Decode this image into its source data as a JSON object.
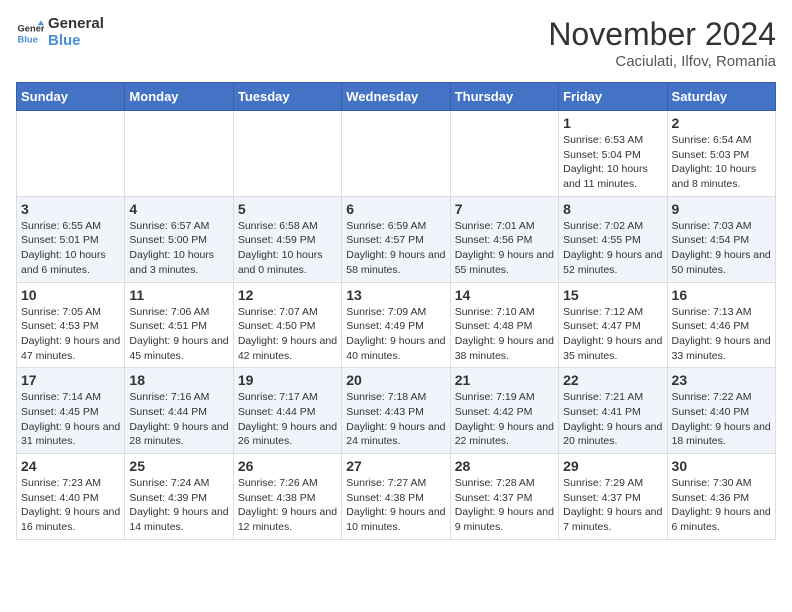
{
  "logo": {
    "line1": "General",
    "line2": "Blue"
  },
  "title": "November 2024",
  "subtitle": "Caciulati, Ilfov, Romania",
  "weekdays": [
    "Sunday",
    "Monday",
    "Tuesday",
    "Wednesday",
    "Thursday",
    "Friday",
    "Saturday"
  ],
  "weeks": [
    [
      {
        "day": "",
        "text": ""
      },
      {
        "day": "",
        "text": ""
      },
      {
        "day": "",
        "text": ""
      },
      {
        "day": "",
        "text": ""
      },
      {
        "day": "",
        "text": ""
      },
      {
        "day": "1",
        "text": "Sunrise: 6:53 AM\nSunset: 5:04 PM\nDaylight: 10 hours and 11 minutes."
      },
      {
        "day": "2",
        "text": "Sunrise: 6:54 AM\nSunset: 5:03 PM\nDaylight: 10 hours and 8 minutes."
      }
    ],
    [
      {
        "day": "3",
        "text": "Sunrise: 6:55 AM\nSunset: 5:01 PM\nDaylight: 10 hours and 6 minutes."
      },
      {
        "day": "4",
        "text": "Sunrise: 6:57 AM\nSunset: 5:00 PM\nDaylight: 10 hours and 3 minutes."
      },
      {
        "day": "5",
        "text": "Sunrise: 6:58 AM\nSunset: 4:59 PM\nDaylight: 10 hours and 0 minutes."
      },
      {
        "day": "6",
        "text": "Sunrise: 6:59 AM\nSunset: 4:57 PM\nDaylight: 9 hours and 58 minutes."
      },
      {
        "day": "7",
        "text": "Sunrise: 7:01 AM\nSunset: 4:56 PM\nDaylight: 9 hours and 55 minutes."
      },
      {
        "day": "8",
        "text": "Sunrise: 7:02 AM\nSunset: 4:55 PM\nDaylight: 9 hours and 52 minutes."
      },
      {
        "day": "9",
        "text": "Sunrise: 7:03 AM\nSunset: 4:54 PM\nDaylight: 9 hours and 50 minutes."
      }
    ],
    [
      {
        "day": "10",
        "text": "Sunrise: 7:05 AM\nSunset: 4:53 PM\nDaylight: 9 hours and 47 minutes."
      },
      {
        "day": "11",
        "text": "Sunrise: 7:06 AM\nSunset: 4:51 PM\nDaylight: 9 hours and 45 minutes."
      },
      {
        "day": "12",
        "text": "Sunrise: 7:07 AM\nSunset: 4:50 PM\nDaylight: 9 hours and 42 minutes."
      },
      {
        "day": "13",
        "text": "Sunrise: 7:09 AM\nSunset: 4:49 PM\nDaylight: 9 hours and 40 minutes."
      },
      {
        "day": "14",
        "text": "Sunrise: 7:10 AM\nSunset: 4:48 PM\nDaylight: 9 hours and 38 minutes."
      },
      {
        "day": "15",
        "text": "Sunrise: 7:12 AM\nSunset: 4:47 PM\nDaylight: 9 hours and 35 minutes."
      },
      {
        "day": "16",
        "text": "Sunrise: 7:13 AM\nSunset: 4:46 PM\nDaylight: 9 hours and 33 minutes."
      }
    ],
    [
      {
        "day": "17",
        "text": "Sunrise: 7:14 AM\nSunset: 4:45 PM\nDaylight: 9 hours and 31 minutes."
      },
      {
        "day": "18",
        "text": "Sunrise: 7:16 AM\nSunset: 4:44 PM\nDaylight: 9 hours and 28 minutes."
      },
      {
        "day": "19",
        "text": "Sunrise: 7:17 AM\nSunset: 4:44 PM\nDaylight: 9 hours and 26 minutes."
      },
      {
        "day": "20",
        "text": "Sunrise: 7:18 AM\nSunset: 4:43 PM\nDaylight: 9 hours and 24 minutes."
      },
      {
        "day": "21",
        "text": "Sunrise: 7:19 AM\nSunset: 4:42 PM\nDaylight: 9 hours and 22 minutes."
      },
      {
        "day": "22",
        "text": "Sunrise: 7:21 AM\nSunset: 4:41 PM\nDaylight: 9 hours and 20 minutes."
      },
      {
        "day": "23",
        "text": "Sunrise: 7:22 AM\nSunset: 4:40 PM\nDaylight: 9 hours and 18 minutes."
      }
    ],
    [
      {
        "day": "24",
        "text": "Sunrise: 7:23 AM\nSunset: 4:40 PM\nDaylight: 9 hours and 16 minutes."
      },
      {
        "day": "25",
        "text": "Sunrise: 7:24 AM\nSunset: 4:39 PM\nDaylight: 9 hours and 14 minutes."
      },
      {
        "day": "26",
        "text": "Sunrise: 7:26 AM\nSunset: 4:38 PM\nDaylight: 9 hours and 12 minutes."
      },
      {
        "day": "27",
        "text": "Sunrise: 7:27 AM\nSunset: 4:38 PM\nDaylight: 9 hours and 10 minutes."
      },
      {
        "day": "28",
        "text": "Sunrise: 7:28 AM\nSunset: 4:37 PM\nDaylight: 9 hours and 9 minutes."
      },
      {
        "day": "29",
        "text": "Sunrise: 7:29 AM\nSunset: 4:37 PM\nDaylight: 9 hours and 7 minutes."
      },
      {
        "day": "30",
        "text": "Sunrise: 7:30 AM\nSunset: 4:36 PM\nDaylight: 9 hours and 6 minutes."
      }
    ]
  ]
}
